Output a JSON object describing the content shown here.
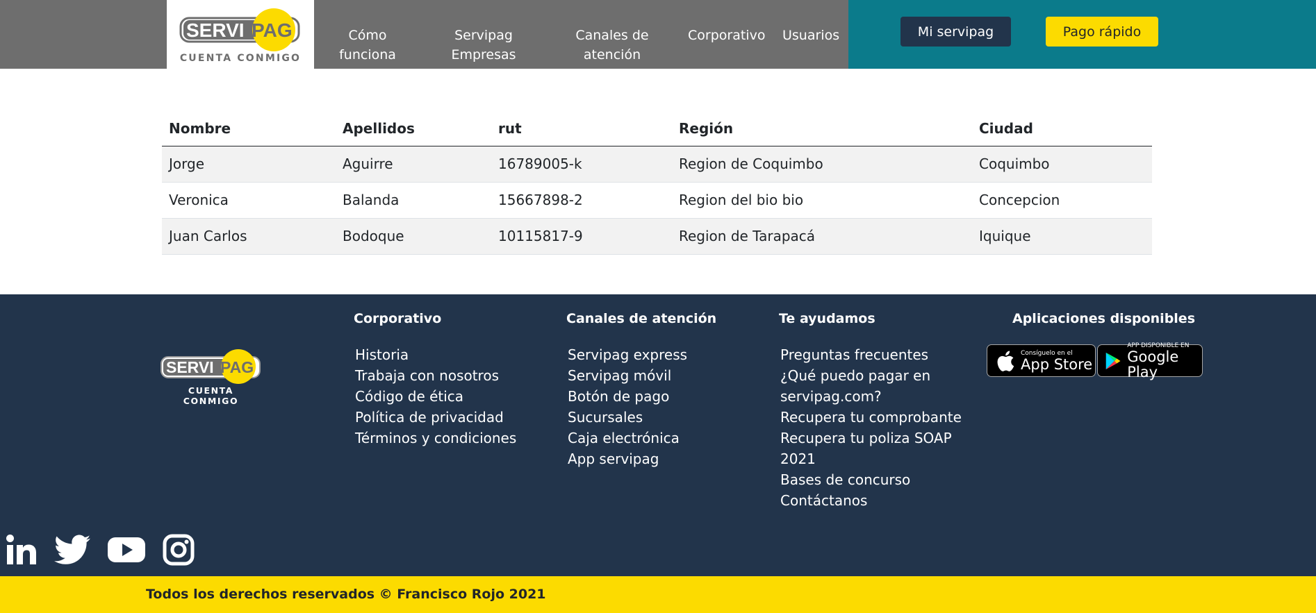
{
  "brand": {
    "logo_text_left": "SERVI",
    "logo_text_right": "PAG",
    "tagline": "CUENTA CONMIGO",
    "colors": {
      "gray": "#6e6e6e",
      "teal": "#0b7b8b",
      "navy": "#22344b",
      "yellow": "#fcdb00"
    }
  },
  "nav": {
    "items": [
      {
        "line1": "Cómo",
        "line2": "funciona"
      },
      {
        "line1": "Servipag",
        "line2": "Empresas"
      },
      {
        "line1": "Canales de",
        "line2": "atención"
      },
      {
        "line1": "Corporativo",
        "line2": ""
      },
      {
        "line1": "Usuarios",
        "line2": ""
      }
    ],
    "mi_servipag": "Mi servipag",
    "pago_rapido": "Pago rápido"
  },
  "table": {
    "headers": [
      "Nombre",
      "Apellidos",
      "rut",
      "Región",
      "Ciudad"
    ],
    "rows": [
      [
        "Jorge",
        "Aguirre",
        "16789005-k",
        "Region de Coquimbo",
        "Coquimbo"
      ],
      [
        "Veronica",
        "Balanda",
        "15667898-2",
        "Region del bio bio",
        "Concepcion"
      ],
      [
        "Juan Carlos",
        "Bodoque",
        "10115817-9",
        "Region de Tarapacá",
        "Iquique"
      ]
    ]
  },
  "footer": {
    "corporativo": {
      "title": "Corporativo",
      "links": [
        "Historia",
        "Trabaja con nosotros",
        "Código de ética",
        "Política de privacidad",
        "Términos y condiciones"
      ]
    },
    "canales": {
      "title": "Canales de atención",
      "links": [
        "Servipag express",
        "Servipag móvil",
        "Botón de pago",
        "Sucursales",
        "Caja electrónica",
        "App servipag"
      ]
    },
    "ayudamos": {
      "title": "Te ayudamos",
      "links": [
        "Preguntas frecuentes",
        "¿Qué puedo pagar en",
        "servipag.com?",
        "Recupera tu comprobante",
        "Recupera tu poliza SOAP",
        "2021",
        "Bases de concurso",
        "Contáctanos"
      ]
    },
    "apps": {
      "title": "Aplicaciones disponibles",
      "appstore_small": "Consíguelo en el",
      "appstore_big": "App Store",
      "googleplay_small": "APP DISPONIBLE EN",
      "googleplay_big": "Google Play"
    },
    "social_icons": [
      "linkedin-icon",
      "twitter-icon",
      "youtube-icon",
      "instagram-icon"
    ]
  },
  "copyright": "Todos los derechos reservados © Francisco Rojo 2021"
}
